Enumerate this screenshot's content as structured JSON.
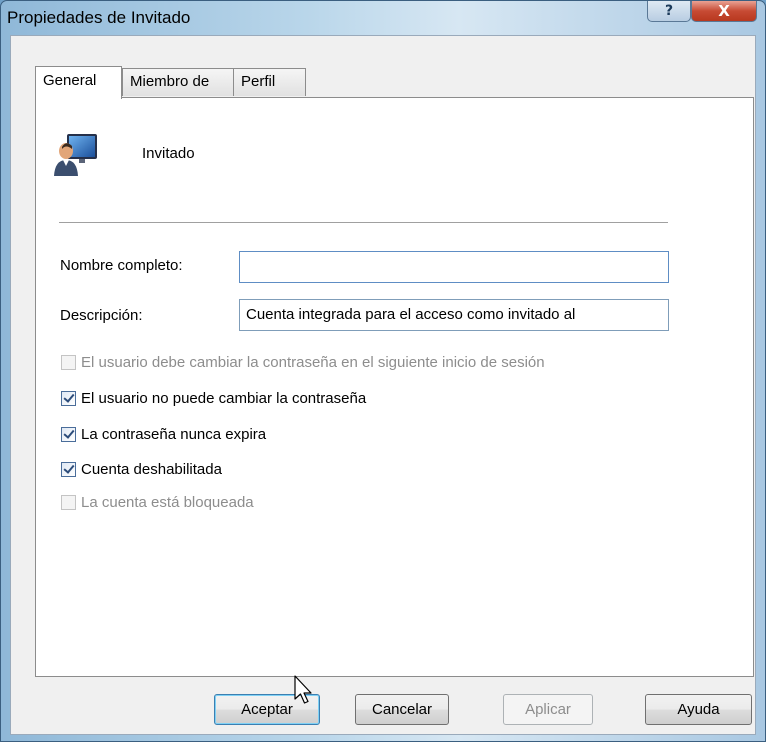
{
  "window": {
    "title": "Propiedades de Invitado",
    "help_symbol": "?",
    "close_symbol": "X"
  },
  "tabs": [
    {
      "label": "General",
      "active": true
    },
    {
      "label": "Miembro de",
      "active": false
    },
    {
      "label": "Perfil",
      "active": false
    }
  ],
  "user": {
    "icon": "user-computer-icon",
    "name": "Invitado"
  },
  "fields": {
    "full_name": {
      "label": "Nombre completo:",
      "value": ""
    },
    "description": {
      "label": "Descripción:",
      "value": "Cuenta integrada para el acceso como invitado al"
    }
  },
  "checkboxes": [
    {
      "label": "El usuario debe cambiar la contraseña en el siguiente inicio de sesión",
      "checked": false,
      "enabled": false
    },
    {
      "label": "El usuario no puede cambiar la contraseña",
      "checked": true,
      "enabled": true
    },
    {
      "label": "La contraseña nunca expira",
      "checked": true,
      "enabled": true
    },
    {
      "label": "Cuenta deshabilitada",
      "checked": true,
      "enabled": true
    },
    {
      "label": "La cuenta está bloqueada",
      "checked": false,
      "enabled": false
    }
  ],
  "buttons": {
    "ok": "Aceptar",
    "cancel": "Cancelar",
    "apply": "Aplicar",
    "help": "Ayuda"
  },
  "colors": {
    "close_button": "#c74b34",
    "title_bar": "#b9d6ea",
    "field_border": "#7f9db9"
  }
}
